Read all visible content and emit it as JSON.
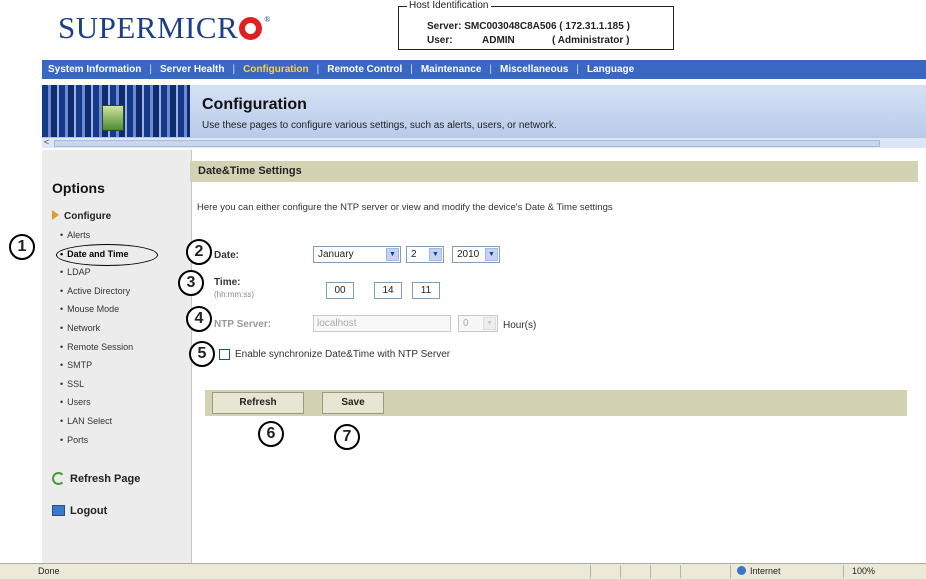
{
  "brand": {
    "logo_text": "SUPERMICR",
    "trademark": "®"
  },
  "host": {
    "legend": "Host Identification",
    "server_label": "Server:",
    "server_value": "SMC003048C8A506 ( 172.31.1.185 )",
    "user_label": "User:",
    "user_value": "ADMIN",
    "user_role": "( Administrator )"
  },
  "nav": {
    "items": [
      {
        "label": "System Information"
      },
      {
        "label": "Server Health"
      },
      {
        "label": "Configuration",
        "active": true
      },
      {
        "label": "Remote Control"
      },
      {
        "label": "Maintenance"
      },
      {
        "label": "Miscellaneous"
      },
      {
        "label": "Language"
      }
    ],
    "separator": "|"
  },
  "banner": {
    "title": "Configuration",
    "description": "Use these pages to configure various settings, such as alerts, users, or network.",
    "scroll_arrow": "<"
  },
  "sidebar": {
    "title": "Options",
    "section": "Configure",
    "items": [
      {
        "label": "Alerts"
      },
      {
        "label": "Date and Time",
        "current": true
      },
      {
        "label": "LDAP"
      },
      {
        "label": "Active Directory"
      },
      {
        "label": "Mouse Mode"
      },
      {
        "label": "Network"
      },
      {
        "label": "Remote Session"
      },
      {
        "label": "SMTP"
      },
      {
        "label": "SSL"
      },
      {
        "label": "Users"
      },
      {
        "label": "LAN Select"
      },
      {
        "label": "Ports"
      }
    ],
    "refresh_page": "Refresh Page",
    "logout": "Logout"
  },
  "content": {
    "section_title": "Date&Time Settings",
    "intro": "Here you can either configure the NTP server or view and modify the device's Date & Time settings",
    "date_label": "Date:",
    "date_month": "January",
    "date_day": "2",
    "date_year": "2010",
    "time_label": "Time:",
    "time_hint": "(hh:mm:ss)",
    "time_hh": "00",
    "time_mm": "14",
    "time_ss": "11",
    "ntp_label": "NTP Server:",
    "ntp_placeholder": "localhost",
    "ntp_offset": "0",
    "ntp_unit": "Hour(s)",
    "sync_label": "Enable synchronize Date&Time with NTP Server",
    "sync_checked": false,
    "refresh_button": "Refresh",
    "save_button": "Save"
  },
  "callouts": [
    "1",
    "2",
    "3",
    "4",
    "5",
    "6",
    "7"
  ],
  "statusbar": {
    "status": "Done",
    "zone": "Internet",
    "zoom": "100%"
  },
  "icons": {
    "dropdown": "▼",
    "configure": "triangle-right-icon",
    "refresh": "refresh-icon",
    "logout": "logout-icon",
    "internet": "globe-icon"
  },
  "colors": {
    "nav_bg": "#3a66c4",
    "nav_active": "#ffd23a",
    "logo_blue": "#1d3f86",
    "logo_red": "#e02020",
    "section_bar": "#d3d3b4"
  }
}
